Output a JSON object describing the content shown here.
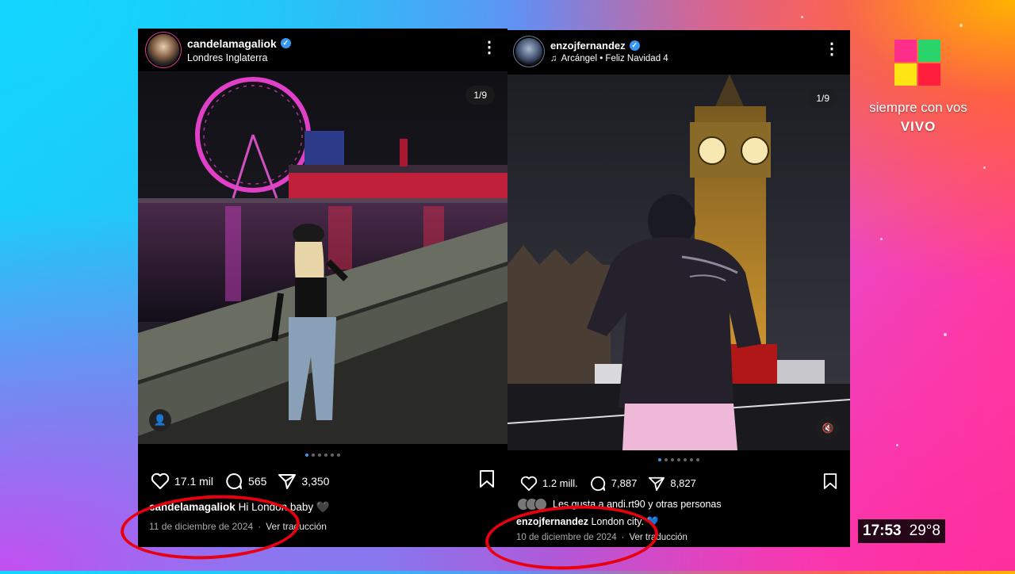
{
  "channel": {
    "tagline": "siempre con vos",
    "live_label": "VIVO",
    "time": "17:53",
    "temperature": "29°8",
    "logo_colors": [
      "#ff2e8a",
      "#2ad46a",
      "#ffe414",
      "#ff1e3c"
    ]
  },
  "posts": [
    {
      "username": "candelamagaliok",
      "subtitle": "Londres Inglaterra",
      "counter": "1/9",
      "likes": "17.1 mil",
      "comments": "565",
      "shares": "3,350",
      "caption_user": "candelamagaliok",
      "caption_text": "Hi London baby 🖤",
      "date": "11 de diciembre de 2024",
      "separator": "·",
      "translate": "Ver traducción",
      "carousel_dots": 6,
      "active_dot": 0
    },
    {
      "username": "enzojfernandez",
      "subtitle": "Arcángel • Feliz Navidad 4",
      "counter": "1/9",
      "likes": "1.2 mill.",
      "comments": "7,887",
      "shares": "8,827",
      "liked_by": "Les gusta a andi.rt90 y otras personas",
      "caption_user": "enzojfernandez",
      "caption_text": "London city. 💙",
      "date": "10 de diciembre de 2024",
      "separator": "·",
      "translate": "Ver traducción",
      "carousel_dots": 7,
      "active_dot": 0
    }
  ],
  "icons": {
    "like": "heart-icon",
    "comment": "comment-icon",
    "share": "send-icon",
    "save": "bookmark-icon",
    "more": "more-vertical-icon",
    "verified": "verified-badge-icon",
    "music": "music-note-icon",
    "user_tag": "user-tag-icon",
    "mute": "speaker-muted-icon"
  },
  "accent_colors": {
    "verified": "#3897f0",
    "highlight_oval": "#e8000e"
  }
}
